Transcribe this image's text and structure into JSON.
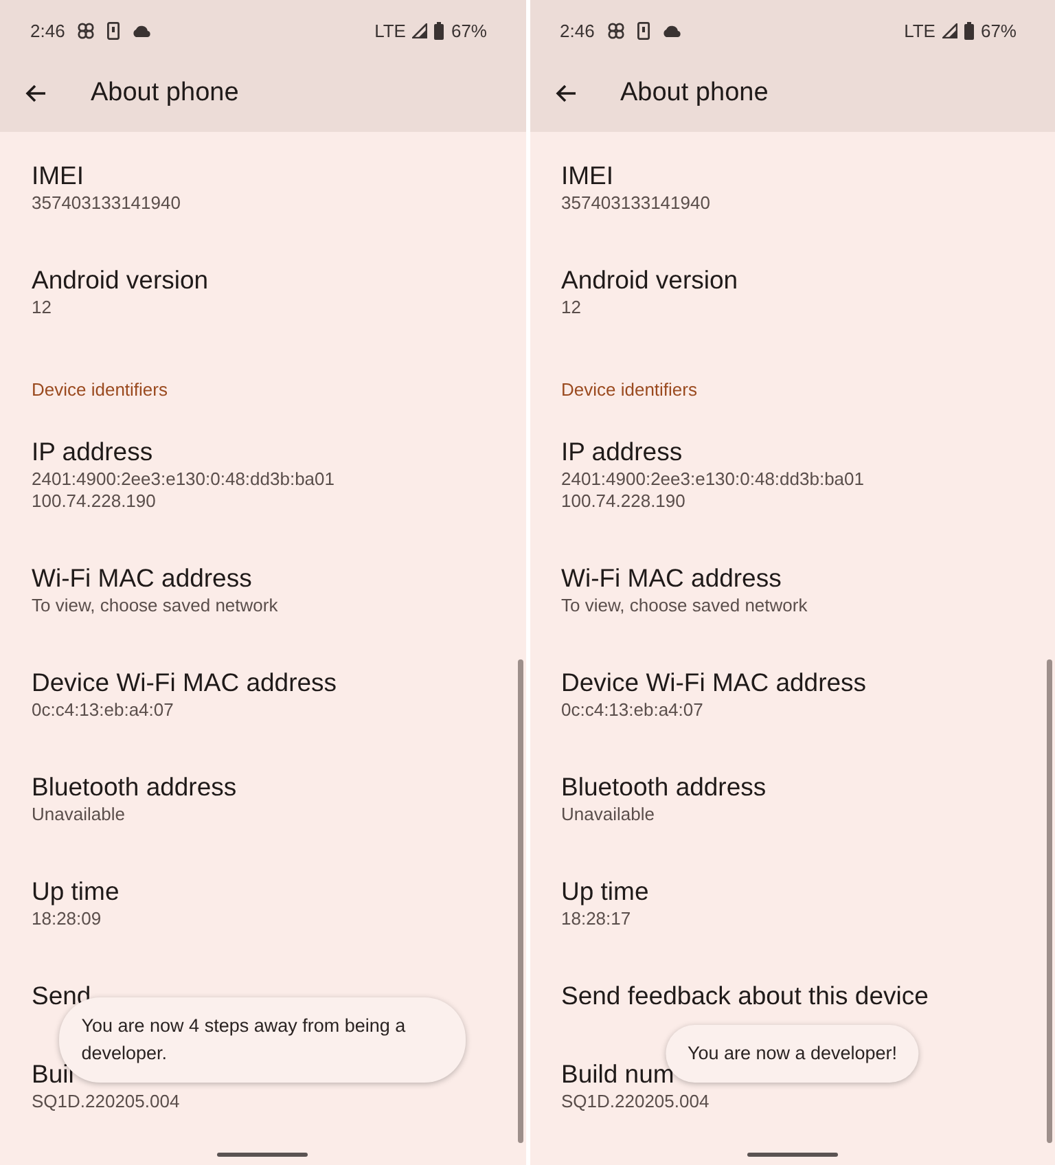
{
  "screens": [
    {
      "status_bar": {
        "time": "2:46",
        "network": "LTE",
        "battery": "67%"
      },
      "app_bar": {
        "title": "About phone"
      },
      "items": [
        {
          "kind": "item",
          "title": "IMEI",
          "values": [
            "357403133141940"
          ]
        },
        {
          "kind": "item",
          "title": "Android version",
          "values": [
            "12"
          ]
        },
        {
          "kind": "header",
          "title": "Device identifiers"
        },
        {
          "kind": "item",
          "title": "IP address",
          "values": [
            "2401:4900:2ee3:e130:0:48:dd3b:ba01",
            "100.74.228.190"
          ]
        },
        {
          "kind": "item",
          "title": "Wi-Fi MAC address",
          "values": [
            "To view, choose saved network"
          ]
        },
        {
          "kind": "item",
          "title": "Device Wi-Fi MAC address",
          "values": [
            "0c:c4:13:eb:a4:07"
          ]
        },
        {
          "kind": "item",
          "title": "Bluetooth address",
          "values": [
            "Unavailable"
          ]
        },
        {
          "kind": "item",
          "title": "Up time",
          "values": [
            "18:28:09"
          ]
        },
        {
          "kind": "item",
          "title": "Send"
        },
        {
          "kind": "item",
          "title": "Buil",
          "values": [
            "SQ1D.220205.004"
          ]
        }
      ],
      "toast": {
        "text": "You are now 4 steps away from being a developer."
      }
    },
    {
      "status_bar": {
        "time": "2:46",
        "network": "LTE",
        "battery": "67%"
      },
      "app_bar": {
        "title": "About phone"
      },
      "items": [
        {
          "kind": "item",
          "title": "IMEI",
          "values": [
            "357403133141940"
          ]
        },
        {
          "kind": "item",
          "title": "Android version",
          "values": [
            "12"
          ]
        },
        {
          "kind": "header",
          "title": "Device identifiers"
        },
        {
          "kind": "item",
          "title": "IP address",
          "values": [
            "2401:4900:2ee3:e130:0:48:dd3b:ba01",
            "100.74.228.190"
          ]
        },
        {
          "kind": "item",
          "title": "Wi-Fi MAC address",
          "values": [
            "To view, choose saved network"
          ]
        },
        {
          "kind": "item",
          "title": "Device Wi-Fi MAC address",
          "values": [
            "0c:c4:13:eb:a4:07"
          ]
        },
        {
          "kind": "item",
          "title": "Bluetooth address",
          "values": [
            "Unavailable"
          ]
        },
        {
          "kind": "item",
          "title": "Up time",
          "values": [
            "18:28:17"
          ]
        },
        {
          "kind": "item",
          "title": "Send feedback about this device"
        },
        {
          "kind": "item",
          "title": "Build num",
          "values": [
            "SQ1D.220205.004"
          ]
        }
      ],
      "toast": {
        "text": "You are now a developer!"
      }
    }
  ]
}
